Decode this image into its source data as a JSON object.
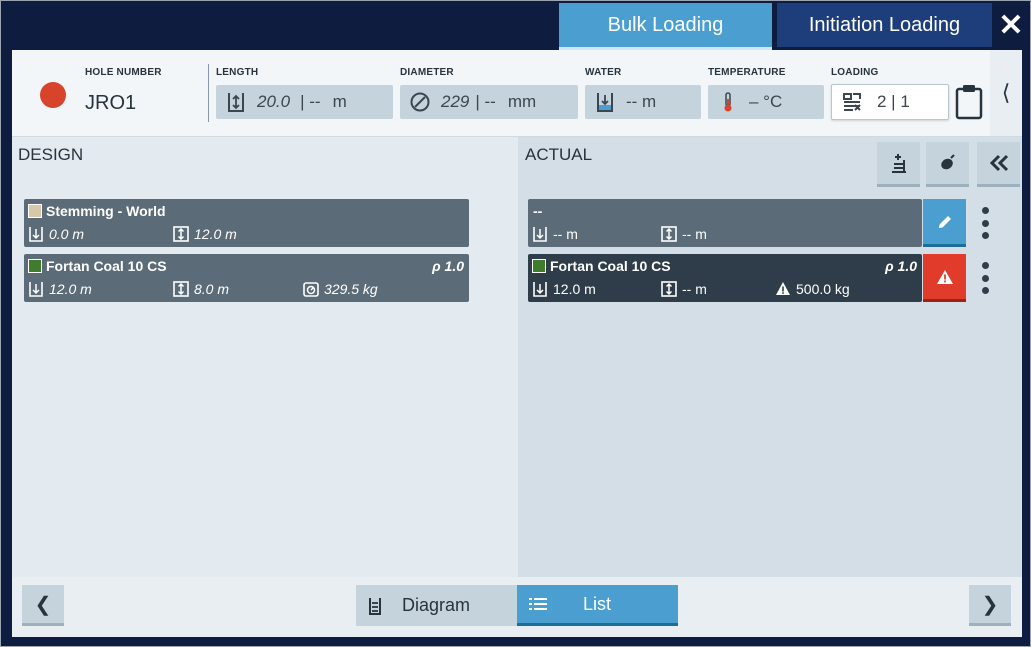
{
  "tabs": {
    "bulk_loading": "Bulk Loading",
    "initiation_loading": "Initiation Loading",
    "close_glyph": "✕"
  },
  "colors": {
    "accent": "#4a9fd0",
    "navy": "#0e1c3f",
    "status_red": "#d8432b",
    "alert_red": "#e03b2b"
  },
  "hole": {
    "number_label": "HOLE NUMBER",
    "number": "JRO1",
    "length_label": "LENGTH",
    "length_value": "20.0",
    "length_sep": "|  --",
    "length_unit": "m",
    "diameter_label": "DIAMETER",
    "diameter_value": "229",
    "diameter_sep": "| --",
    "diameter_unit": "mm",
    "water_label": "WATER",
    "water_value": "-- m",
    "temperature_label": "TEMPERATURE",
    "temperature_value": "– °C",
    "loading_label": "LOADING",
    "loading_value": "2 | 1",
    "side_toggle": "⟨"
  },
  "design": {
    "title": "DESIGN",
    "decks": [
      {
        "name": "Stemming - World",
        "depth": "0.0 m",
        "length": "12.0 m",
        "swatch": "#d6c8a8"
      },
      {
        "name": "Fortan Coal 10 CS",
        "rho": "ρ 1.0",
        "depth": "12.0 m",
        "length": "8.0 m",
        "mass": "329.5 kg",
        "swatch": "#3f7d2c"
      }
    ]
  },
  "actual": {
    "title": "ACTUAL",
    "decks": [
      {
        "name": "--",
        "depth": "-- m",
        "length": "-- m"
      },
      {
        "name": "Fortan Coal 10 CS",
        "rho": "ρ 1.0",
        "depth": "12.0 m",
        "length": "-- m",
        "mass": "500.0 kg",
        "swatch": "#3f7d2c"
      }
    ]
  },
  "footer": {
    "prev_glyph": "❮",
    "next_glyph": "❯",
    "diagram_label": "Diagram",
    "list_label": "List"
  },
  "icons": [
    "close-icon",
    "length-icon",
    "diameter-icon",
    "water-icon",
    "thermometer-icon",
    "loading-icon",
    "clipboard-icon",
    "add-deck-icon",
    "primer-icon",
    "collapse-icon",
    "depth-icon",
    "deck-length-icon",
    "mass-icon",
    "edit-icon",
    "warning-icon",
    "more-icon",
    "chevron-left-icon",
    "chevron-right-icon",
    "diagram-icon",
    "list-icon"
  ]
}
